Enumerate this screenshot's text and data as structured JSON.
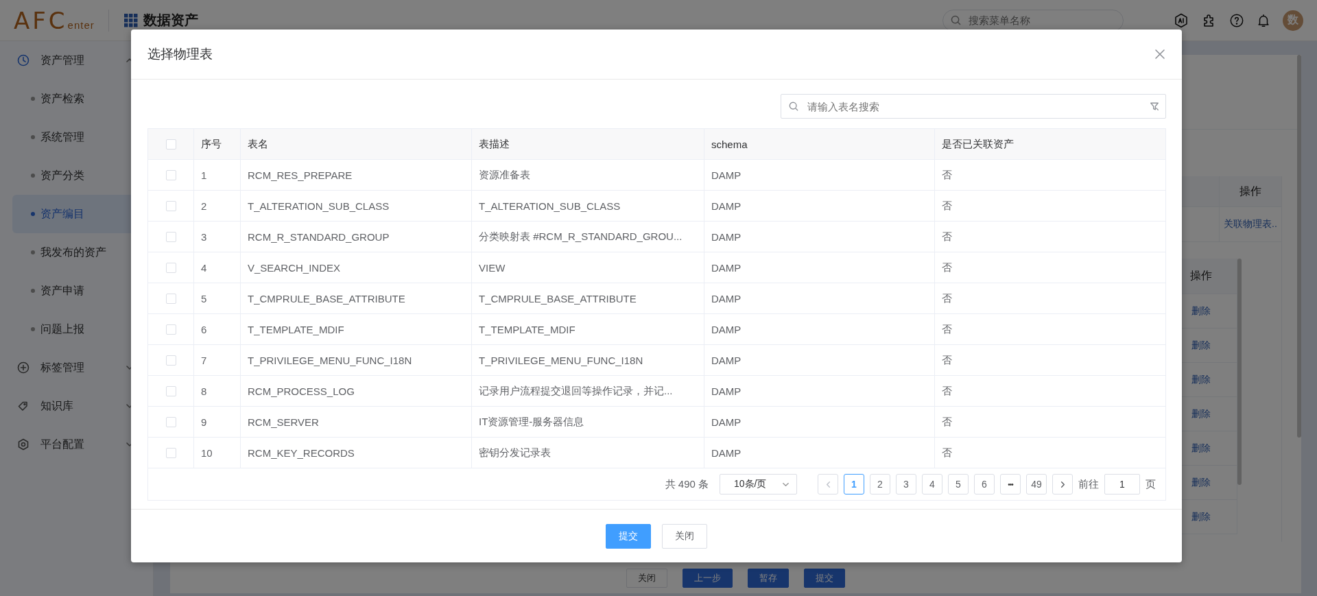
{
  "header": {
    "logo": {
      "main": "AFC",
      "sub": "enter"
    },
    "app_title": "数据资产",
    "search": {
      "placeholder": "搜索菜单名称"
    },
    "avatar": "数"
  },
  "sidebar": {
    "items": [
      {
        "label": "资产管理",
        "expanded": true,
        "children": [
          {
            "label": "资产检索",
            "selected": false
          },
          {
            "label": "系统管理",
            "selected": false
          },
          {
            "label": "资产分类",
            "selected": false
          },
          {
            "label": "资产编目",
            "selected": true
          },
          {
            "label": "我发布的资产",
            "selected": false
          },
          {
            "label": "资产申请",
            "selected": false
          },
          {
            "label": "问题上报",
            "selected": false
          }
        ]
      },
      {
        "label": "标签管理",
        "expanded": false
      },
      {
        "label": "知识库",
        "expanded": false
      },
      {
        "label": "平台配置",
        "expanded": false
      }
    ]
  },
  "background_page": {
    "outer_table": {
      "action_header": "操作",
      "rows": [
        {
          "action": "关联物理表.."
        }
      ]
    },
    "inner_table": {
      "action_header": "操作",
      "rows": [
        {
          "action": "删除"
        },
        {
          "action": "删除"
        },
        {
          "action": "删除"
        },
        {
          "action": "删除"
        },
        {
          "action": "删除"
        },
        {
          "action": "删除"
        },
        {
          "action": "删除"
        }
      ]
    },
    "buttons": [
      {
        "label": "关闭",
        "kind": "default"
      },
      {
        "label": "上一步",
        "kind": "primary"
      },
      {
        "label": "暂存",
        "kind": "primary"
      },
      {
        "label": "提交",
        "kind": "primary"
      }
    ]
  },
  "dialog": {
    "title": "选择物理表",
    "search": {
      "placeholder": "请输入表名搜索"
    },
    "table": {
      "select_all_checked": false,
      "columns": [
        "序号",
        "表名",
        "表描述",
        "schema",
        "是否已关联资产"
      ],
      "rows": [
        {
          "checked": false,
          "index": "1",
          "name": "RCM_RES_PREPARE",
          "description": "资源准备表",
          "schema": "DAMP",
          "linked": "否"
        },
        {
          "checked": false,
          "index": "2",
          "name": "T_ALTERATION_SUB_CLASS",
          "description": "T_ALTERATION_SUB_CLASS",
          "schema": "DAMP",
          "linked": "否"
        },
        {
          "checked": false,
          "index": "3",
          "name": "RCM_R_STANDARD_GROUP",
          "description": "分类映射表 #RCM_R_STANDARD_GROU...",
          "schema": "DAMP",
          "linked": "否"
        },
        {
          "checked": false,
          "index": "4",
          "name": "V_SEARCH_INDEX",
          "description": "VIEW",
          "schema": "DAMP",
          "linked": "否"
        },
        {
          "checked": false,
          "index": "5",
          "name": "T_CMPRULE_BASE_ATTRIBUTE",
          "description": "T_CMPRULE_BASE_ATTRIBUTE",
          "schema": "DAMP",
          "linked": "否"
        },
        {
          "checked": false,
          "index": "6",
          "name": "T_TEMPLATE_MDIF",
          "description": "T_TEMPLATE_MDIF",
          "schema": "DAMP",
          "linked": "否"
        },
        {
          "checked": false,
          "index": "7",
          "name": "T_PRIVILEGE_MENU_FUNC_I18N",
          "description": "T_PRIVILEGE_MENU_FUNC_I18N",
          "schema": "DAMP",
          "linked": "否"
        },
        {
          "checked": false,
          "index": "8",
          "name": "RCM_PROCESS_LOG",
          "description": "记录用户流程提交退回等操作记录，并记...",
          "schema": "DAMP",
          "linked": "否"
        },
        {
          "checked": false,
          "index": "9",
          "name": "RCM_SERVER",
          "description": "IT资源管理-服务器信息",
          "schema": "DAMP",
          "linked": "否"
        },
        {
          "checked": false,
          "index": "10",
          "name": "RCM_KEY_RECORDS",
          "description": "密钥分发记录表",
          "schema": "DAMP",
          "linked": "否"
        }
      ]
    },
    "pagination": {
      "total": "共 490 条",
      "page_size": "10条/页",
      "pages": [
        {
          "label": "1",
          "kind": "page",
          "selected": true
        },
        {
          "label": "2",
          "kind": "page",
          "selected": false
        },
        {
          "label": "3",
          "kind": "page",
          "selected": false
        },
        {
          "label": "4",
          "kind": "page",
          "selected": false
        },
        {
          "label": "5",
          "kind": "page",
          "selected": false
        },
        {
          "label": "6",
          "kind": "page",
          "selected": false
        },
        {
          "label": "•••",
          "kind": "ellipsis",
          "selected": false
        },
        {
          "label": "49",
          "kind": "page",
          "selected": false
        }
      ],
      "jump_label": "前往",
      "jump_value": "1",
      "jump_suffix": "页"
    },
    "buttons": [
      {
        "label": "提交",
        "kind": "primary"
      },
      {
        "label": "关闭",
        "kind": "default"
      }
    ]
  }
}
